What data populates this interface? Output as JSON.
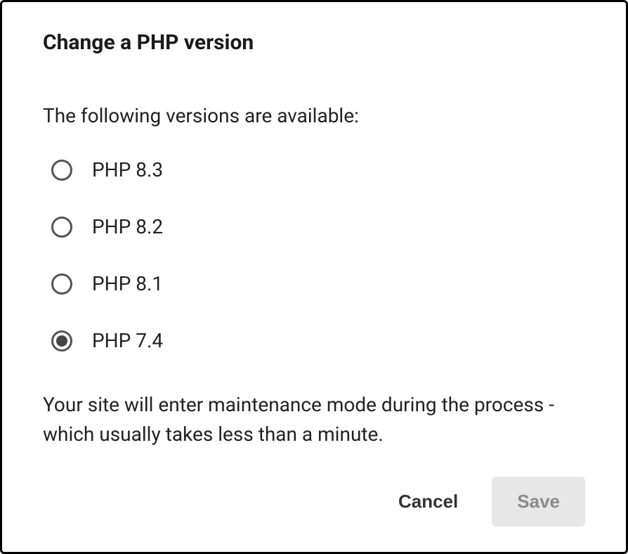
{
  "dialog": {
    "title": "Change a PHP version",
    "intro": "The following versions are available:",
    "options": [
      {
        "label": "PHP 8.3",
        "selected": false
      },
      {
        "label": "PHP 8.2",
        "selected": false
      },
      {
        "label": "PHP 8.1",
        "selected": false
      },
      {
        "label": "PHP 7.4",
        "selected": true
      }
    ],
    "note": "Your site will enter maintenance mode during the process - which usually takes less than a minute.",
    "buttons": {
      "cancel": "Cancel",
      "save": "Save"
    }
  }
}
